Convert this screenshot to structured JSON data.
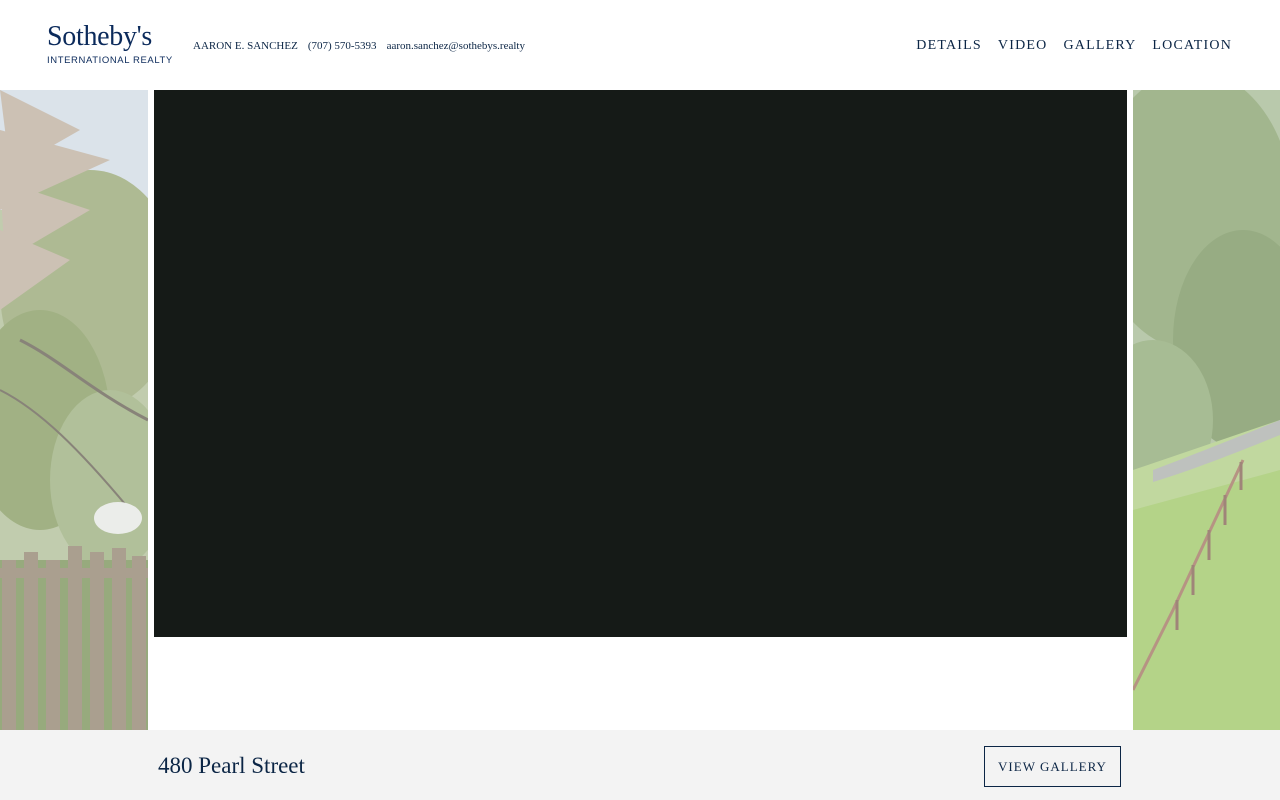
{
  "brand": {
    "name": "Sotheby's",
    "subtitle": "INTERNATIONAL REALTY",
    "color": "#0b2a5b"
  },
  "agent": {
    "name": "AARON E. SANCHEZ",
    "phone": "(707) 570-5393",
    "email": "aaron.sanchez@sothebys.realty"
  },
  "nav": {
    "items": [
      {
        "label": "DETAILS"
      },
      {
        "label": "VIDEO"
      },
      {
        "label": "GALLERY"
      },
      {
        "label": "LOCATION"
      }
    ]
  },
  "hero": {
    "video_background": "#151a17"
  },
  "footer": {
    "address": "480 Pearl Street",
    "gallery_button_label": "VIEW GALLERY",
    "background": "#f3f3f3"
  }
}
